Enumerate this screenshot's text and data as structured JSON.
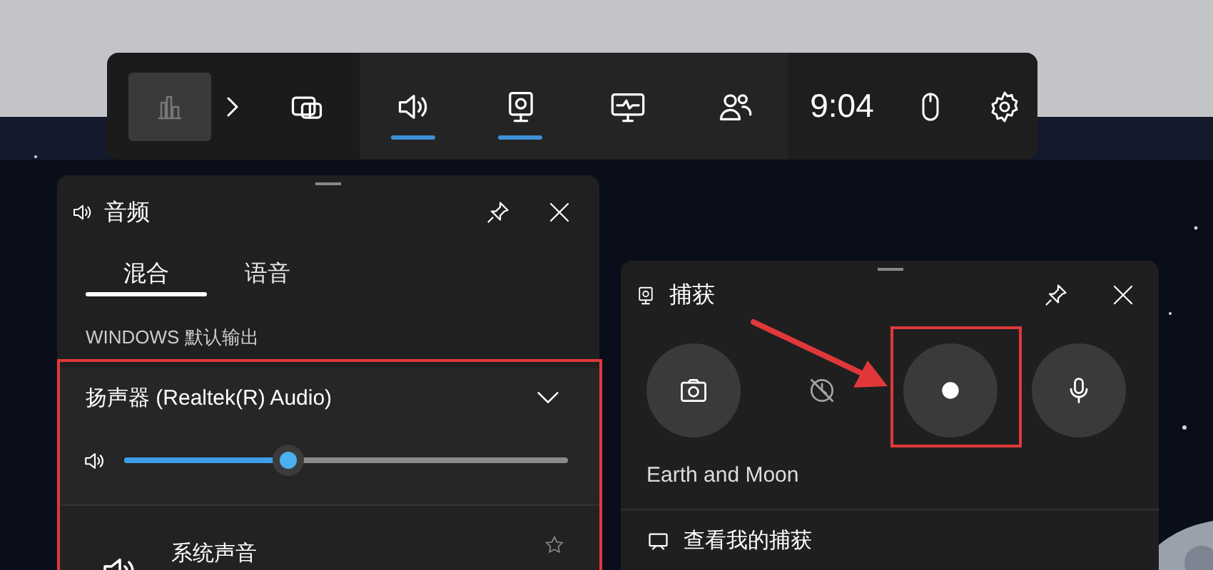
{
  "top_bar": {
    "widgets": [
      {
        "kind": "gallery",
        "selected": false
      },
      {
        "kind": "audio",
        "selected": true
      },
      {
        "kind": "capture",
        "selected": true
      },
      {
        "kind": "performance",
        "selected": false
      },
      {
        "kind": "social",
        "selected": false
      }
    ],
    "time": "9:04"
  },
  "audio_panel": {
    "title": "音频",
    "tabs": [
      {
        "label": "混合",
        "selected": true
      },
      {
        "label": "语音",
        "selected": false
      }
    ],
    "section_label": "WINDOWS 默认输出",
    "device": {
      "name": "扬声器 (Realtek(R) Audio)",
      "level": 0.37
    },
    "apps": [
      {
        "name": "系统声音",
        "favorite": false
      }
    ]
  },
  "capture_panel": {
    "title": "捕获",
    "buttons": [
      {
        "kind": "screenshot",
        "disabled": false
      },
      {
        "kind": "record_last",
        "disabled": true
      },
      {
        "kind": "record",
        "disabled": false
      },
      {
        "kind": "mic",
        "disabled": false
      }
    ],
    "game": "Earth and Moon",
    "gallery_link": "查看我的捕获"
  }
}
